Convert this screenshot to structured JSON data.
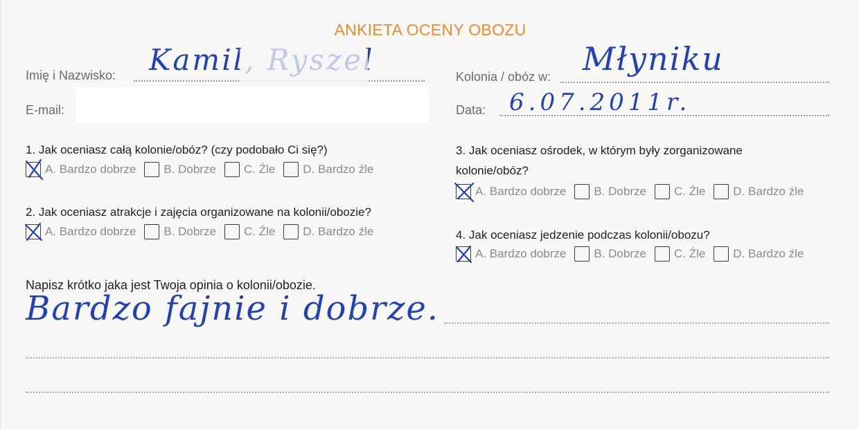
{
  "form": {
    "title": "ANKIETA OCENY OBOZU",
    "name_label": "Imię i Nazwisko:",
    "name_value": "Kamil, Ryszel",
    "email_label": "E-mail:",
    "camp_label": "Kolonia / obóz w:",
    "camp_value": "Młyniku",
    "date_label": "Data:",
    "date_value": "6.07.2011r."
  },
  "questions": [
    {
      "text": "1. Jak oceniasz całą kolonie/obóz? (czy podobało Ci się?)",
      "options": [
        "A. Bardzo dobrze",
        "B. Dobrze",
        "C. Źle",
        "D. Bardzo źle"
      ],
      "checked": "A. Bardzo dobrze"
    },
    {
      "text": "2.  Jak oceniasz atrakcje i zajęcia organizowane na kolonii/obozie?",
      "options": [
        "A. Bardzo dobrze",
        "B. Dobrze",
        "C. Źle",
        "D. Bardzo źle"
      ],
      "checked": "A. Bardzo dobrze"
    },
    {
      "text_line1": "3. Jak oceniasz ośrodek, w którym były zorganizowane",
      "text_line2": "kolonie/obóz?",
      "options": [
        "A. Bardzo dobrze",
        "B. Dobrze",
        "C. Źle",
        "D. Bardzo źle"
      ],
      "checked": "A. Bardzo dobrze"
    },
    {
      "text": "4.  Jak oceniasz jedzenie podczas kolonii/obozu?",
      "options": [
        "A. Bardzo dobrze",
        "B. Dobrze",
        "C. Źle",
        "D. Bardzo źle"
      ],
      "checked": "A. Bardzo dobrze"
    }
  ],
  "opinion": {
    "prompt": "Napisz krótko jaka jest Twoja opinia o kolonii/obozie.",
    "answer": "Bardzo fajnie i dobrze."
  },
  "colors": {
    "title": "#ee8c2c",
    "ink": "#2241b8",
    "checkbox": "#3c3c3c"
  }
}
